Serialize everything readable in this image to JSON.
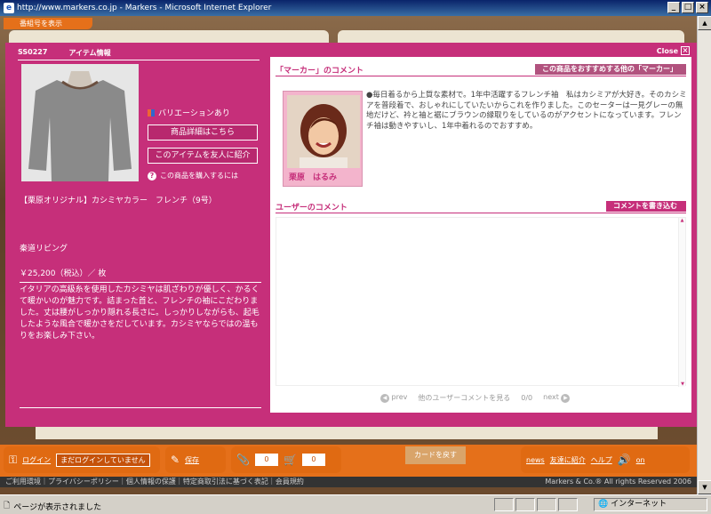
{
  "window": {
    "title": "http://www.markers.co.jp - Markers - Microsoft Internet Explorer",
    "minimize": "_",
    "maximize": "□",
    "close": "×"
  },
  "scene": {
    "numbar_label": "番組号を表示"
  },
  "panel": {
    "close_label": "Close",
    "item_code": "SS0227",
    "item_info_label": "アイテム情報",
    "variation_label": "バリエーションあり",
    "detail_button": "商品詳細はこちら",
    "share_button": "このアイテムを友人に紹介",
    "how_to_buy": "この商品を購入するには",
    "product_name": "【栗原オリジナル】カシミヤカラー　フレンチ（9号）",
    "brand": "秦道リビング",
    "price": "￥25,200（税込）／ 枚",
    "description": "イタリアの高級糸を使用したカシミヤは肌ざわりが優しく、かるくて暖かいのが魅力です。詰まった首と、フレンチの袖にこだわりました。丈は腰がしっかり隠れる長さに。しっかりしながらも、起毛したような風合で暖かさをだしています。カシミヤならではの温もりをお楽しみ下さい。"
  },
  "marker_comment": {
    "heading": "「マーカー」のコメント",
    "recommend_button": "この商品をおすすめする他の「マーカー」",
    "person_name": "栗原　はるみ",
    "comment": "●毎日着るから上質な素材で。1年中活躍するフレンチ袖　私はカシミアが大好き。そのカシミアを普段着で、おしゃれにしていたいからこれを作りました。このセーターは一見グレーの無地だけど、衿と袖と裾にブラウンの縁取りをしているのがアクセントになっています。フレンチ袖は動きやすいし、1年中着れるのでおすすめ。"
  },
  "user_comment": {
    "heading": "ユーザーのコメント",
    "write_button": "コメントを書き込む",
    "prev": "prev",
    "see_others": "他のユーザーコメントを見る",
    "counter": "0/0",
    "next": "next"
  },
  "toolbar": {
    "login": "ログイン",
    "login_status": "まだログインしていません",
    "save": "保存",
    "clip_count": "0",
    "cart_count": "0",
    "card_back": "カードを戻す",
    "news": "news",
    "invite": "友達に紹介",
    "help": "ヘルプ",
    "sound": "on"
  },
  "footer": {
    "links": "ご利用環境｜プライバシーポリシー｜個人情報の保護｜特定商取引法に基づく表記｜会員規約",
    "copyright": "Markers & Co.® All rights Reserved 2006"
  },
  "statusbar": {
    "message": "ページが表示されました",
    "zone": "インターネット"
  }
}
